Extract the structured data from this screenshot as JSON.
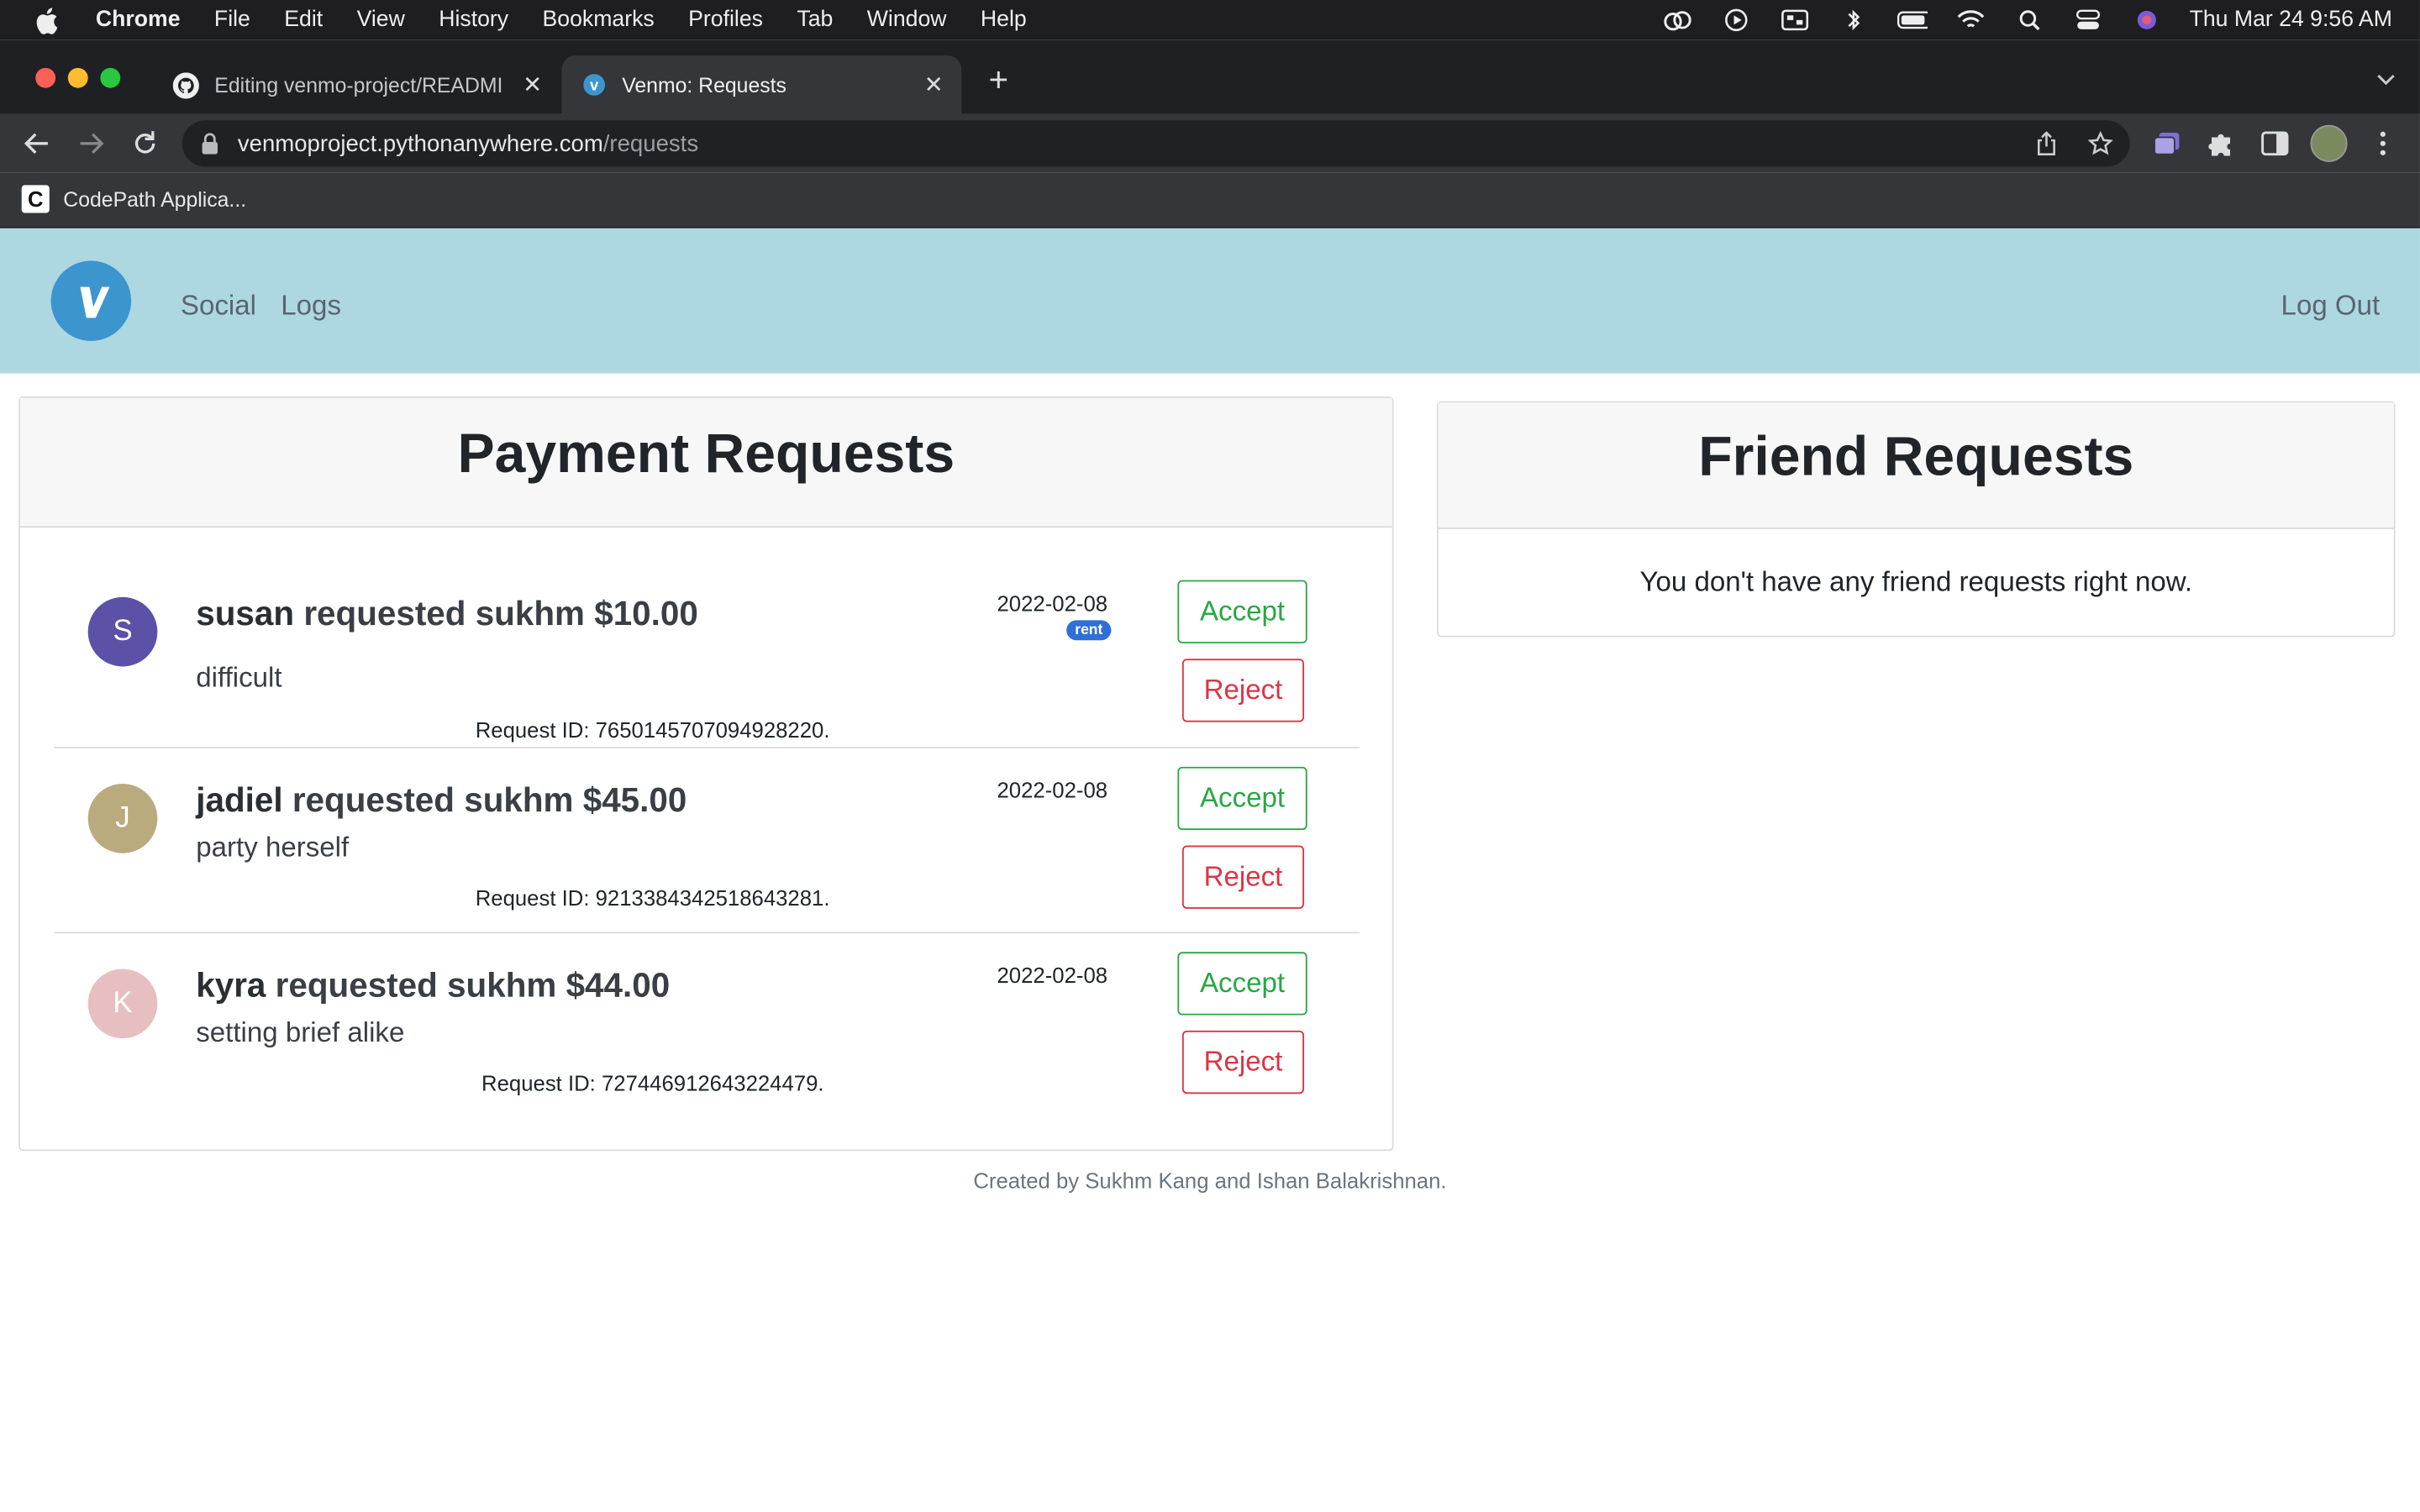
{
  "menubar": {
    "app": "Chrome",
    "items": [
      "File",
      "Edit",
      "View",
      "History",
      "Bookmarks",
      "Profiles",
      "Tab",
      "Window",
      "Help"
    ],
    "clock": "Thu Mar 24  9:56 AM"
  },
  "tabs": [
    {
      "label": "Editing venmo-project/READMI",
      "favicon": "github-icon",
      "active": false
    },
    {
      "label": "Venmo: Requests",
      "favicon": "venmo-icon",
      "active": true
    }
  ],
  "omnibox": {
    "domain": "venmoproject.pythonanywhere.com",
    "path": "/requests"
  },
  "bookmarks": [
    {
      "label": "CodePath Applica...",
      "icon": "codepath-icon"
    }
  ],
  "site": {
    "nav": {
      "social": "Social",
      "logs": "Logs",
      "logout": "Log Out"
    },
    "payment_requests": {
      "title": "Payment Requests",
      "items": [
        {
          "initial": "S",
          "avatar_color": "#5b51a6",
          "requester": "susan",
          "requested_text": "requested",
          "target": "sukhm",
          "amount": "$10.00",
          "note": "difficult",
          "request_id": "Request ID: 7650145707094928220.",
          "date": "2022-02-08",
          "tag": "rent"
        },
        {
          "initial": "J",
          "avatar_color": "#b9ab7e",
          "requester": "jadiel",
          "requested_text": "requested",
          "target": "sukhm",
          "amount": "$45.00",
          "note": "party herself",
          "request_id": "Request ID: 9213384342518643281.",
          "date": "2022-02-08",
          "tag": ""
        },
        {
          "initial": "K",
          "avatar_color": "#e8bfc0",
          "requester": "kyra",
          "requested_text": "requested",
          "target": "sukhm",
          "amount": "$44.00",
          "note": "setting brief alike",
          "request_id": "Request ID: 727446912643224479.",
          "date": "2022-02-08",
          "tag": ""
        }
      ],
      "accept_label": "Accept",
      "reject_label": "Reject"
    },
    "friend_requests": {
      "title": "Friend Requests",
      "empty_text": "You don't have any friend requests right now."
    },
    "footer": "Created by Sukhm Kang and Ishan Balakrishnan."
  },
  "colors": {
    "navbar": "#add8e1",
    "venmo_blue": "#3d95ce",
    "accept": "#28a745",
    "reject": "#dc3545"
  }
}
